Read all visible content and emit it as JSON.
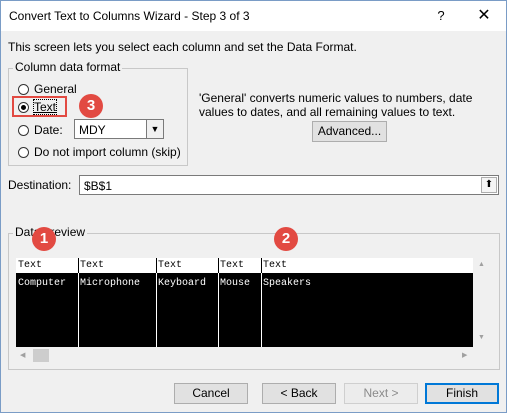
{
  "window": {
    "title": "Convert Text to Columns Wizard - Step 3 of 3",
    "help_label": "?",
    "close_label": "✕"
  },
  "intro_text": "This screen lets you select each column and set the Data Format.",
  "column_format": {
    "title": "Column data format",
    "options": [
      {
        "label": "General",
        "checked": false
      },
      {
        "label": "Text",
        "checked": true
      },
      {
        "label": "Date:",
        "checked": false
      },
      {
        "label": "Do not import column (skip)",
        "checked": false
      }
    ],
    "date_format_value": "MDY"
  },
  "description": "'General' converts numeric values to numbers, date values to dates, and all remaining values to text.",
  "advanced_label": "Advanced...",
  "destination": {
    "label": "Destination:",
    "value": "$B$1"
  },
  "preview": {
    "title": "Data preview",
    "headers": [
      "Text",
      "Text",
      "Text",
      "Text",
      "Text"
    ],
    "cells": [
      "Computer",
      "Microphone",
      "Keyboard",
      "Mouse",
      "Speakers"
    ]
  },
  "annotations": {
    "badge_1": "1",
    "badge_2": "2",
    "badge_3": "3",
    "color": "#e24a42"
  },
  "buttons": {
    "cancel": "Cancel",
    "back": "< Back",
    "next": "Next >",
    "finish": "Finish"
  }
}
